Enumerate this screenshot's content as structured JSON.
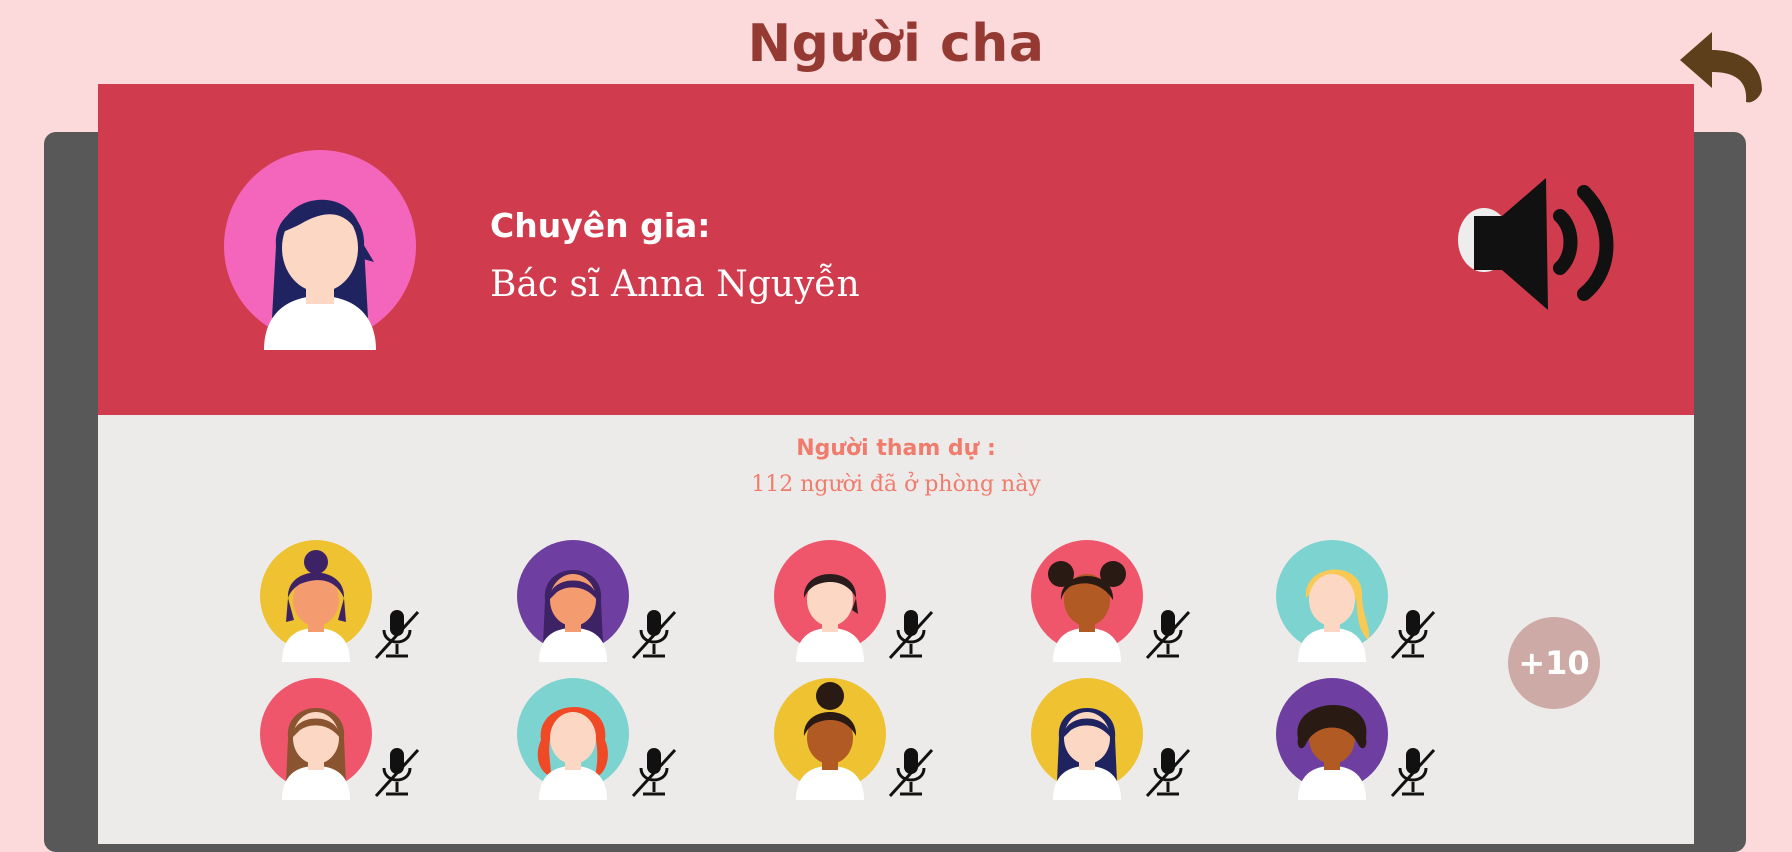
{
  "page": {
    "title": "Người cha"
  },
  "colors": {
    "background": "#fcd9da",
    "title": "#943a32",
    "expert_panel": "#d03c4e",
    "card": "#ecebe9",
    "attendee_text": "#ef7c6d",
    "more_badge": "#ceaaa6",
    "back_arrow": "#5e3f1b"
  },
  "expert": {
    "heading": "Chuyên gia:",
    "name": "Bác sĩ Anna Nguyễn",
    "avatar_icon": "woman-avatar-icon",
    "speaker_icon": "speaker-volume-icon"
  },
  "attendees": {
    "heading": "Người tham dự :",
    "count_text": "112 người đã ở phòng này",
    "more_label": "+10",
    "mic_icon": "mic-muted-icon",
    "participants": [
      {
        "bg": "#eec230",
        "hair": "#3e2266",
        "skin": "#f49c70",
        "style": "bun"
      },
      {
        "bg": "#6e3fa0",
        "hair": "#3e2266",
        "skin": "#f49c70",
        "style": "long"
      },
      {
        "bg": "#f0566b",
        "hair": "#2a1c1c",
        "skin": "#fcd8c4",
        "style": "short"
      },
      {
        "bg": "#f0566b",
        "hair": "#2a1a14",
        "skin": "#b15a24",
        "style": "puffs"
      },
      {
        "bg": "#7dd3cf",
        "hair": "#f8c955",
        "skin": "#fcd8c4",
        "style": "side"
      },
      {
        "bg": "#f0566b",
        "hair": "#8b5430",
        "skin": "#fcd8c4",
        "style": "long"
      },
      {
        "bg": "#7dd3cf",
        "hair": "#ef4a25",
        "skin": "#fcd8c4",
        "style": "curly"
      },
      {
        "bg": "#eec230",
        "hair": "#2a1a14",
        "skin": "#b15a24",
        "style": "topbun"
      },
      {
        "bg": "#eec230",
        "hair": "#1f2360",
        "skin": "#fcd8c4",
        "style": "long"
      },
      {
        "bg": "#6e3fa0",
        "hair": "#2a1a14",
        "skin": "#b15a24",
        "style": "afro"
      }
    ]
  }
}
